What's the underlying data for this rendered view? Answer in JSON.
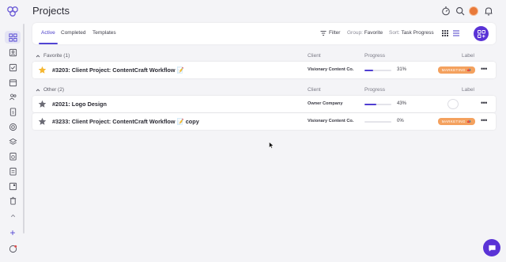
{
  "header": {
    "title": "Projects",
    "icons": [
      "timer-icon",
      "search-icon",
      "avatar",
      "bell-icon"
    ]
  },
  "sidebar": {
    "items": [
      "dashboard-icon",
      "contact-card-icon",
      "checklist-icon",
      "calendar-icon",
      "users-icon",
      "invoice-icon",
      "target-icon",
      "layers-icon",
      "clipboard-clock-icon",
      "clipboard-icon",
      "board-icon",
      "trash-icon"
    ],
    "add_label": "+"
  },
  "tabs": [
    {
      "label": "Active",
      "active": true
    },
    {
      "label": "Completed",
      "active": false
    },
    {
      "label": "Templates",
      "active": false
    }
  ],
  "toolbar": {
    "filter_label": "Filter",
    "group_key": "Group:",
    "group_value": "Favorite",
    "sort_key": "Sort:",
    "sort_value": "Task Progress"
  },
  "columns": {
    "client": "Client",
    "progress": "Progress",
    "label": "Label"
  },
  "groups": [
    {
      "name": "Favorite (1)",
      "rows": [
        {
          "title": "#3203: Client Project: ContentCraft Workflow",
          "emoji": "📝",
          "suffix": "",
          "client": "Visionary Content Co.",
          "progress": 31,
          "progress_text": "31%",
          "label": "MARKETING",
          "label_emoji": "📣",
          "starred": true
        }
      ]
    },
    {
      "name": "Other (2)",
      "rows": [
        {
          "title": "#2021: Logo Design",
          "emoji": "",
          "suffix": "",
          "client": "Owner Company",
          "progress": 43,
          "progress_text": "43%",
          "label": "",
          "label_emoji": "",
          "starred": false
        },
        {
          "title": "#3233: Client Project: ContentCraft Workflow",
          "emoji": "📝",
          "suffix": "copy",
          "client": "Visionary Content Co.",
          "progress": 0,
          "progress_text": "0%",
          "label": "MARKETING",
          "label_emoji": "📣",
          "starred": false
        }
      ]
    }
  ],
  "colors": {
    "accent": "#5a33d6",
    "star_favorite": "#f5b731",
    "star_default": "#6b6b75",
    "label_marketing": "#f4a15e"
  }
}
